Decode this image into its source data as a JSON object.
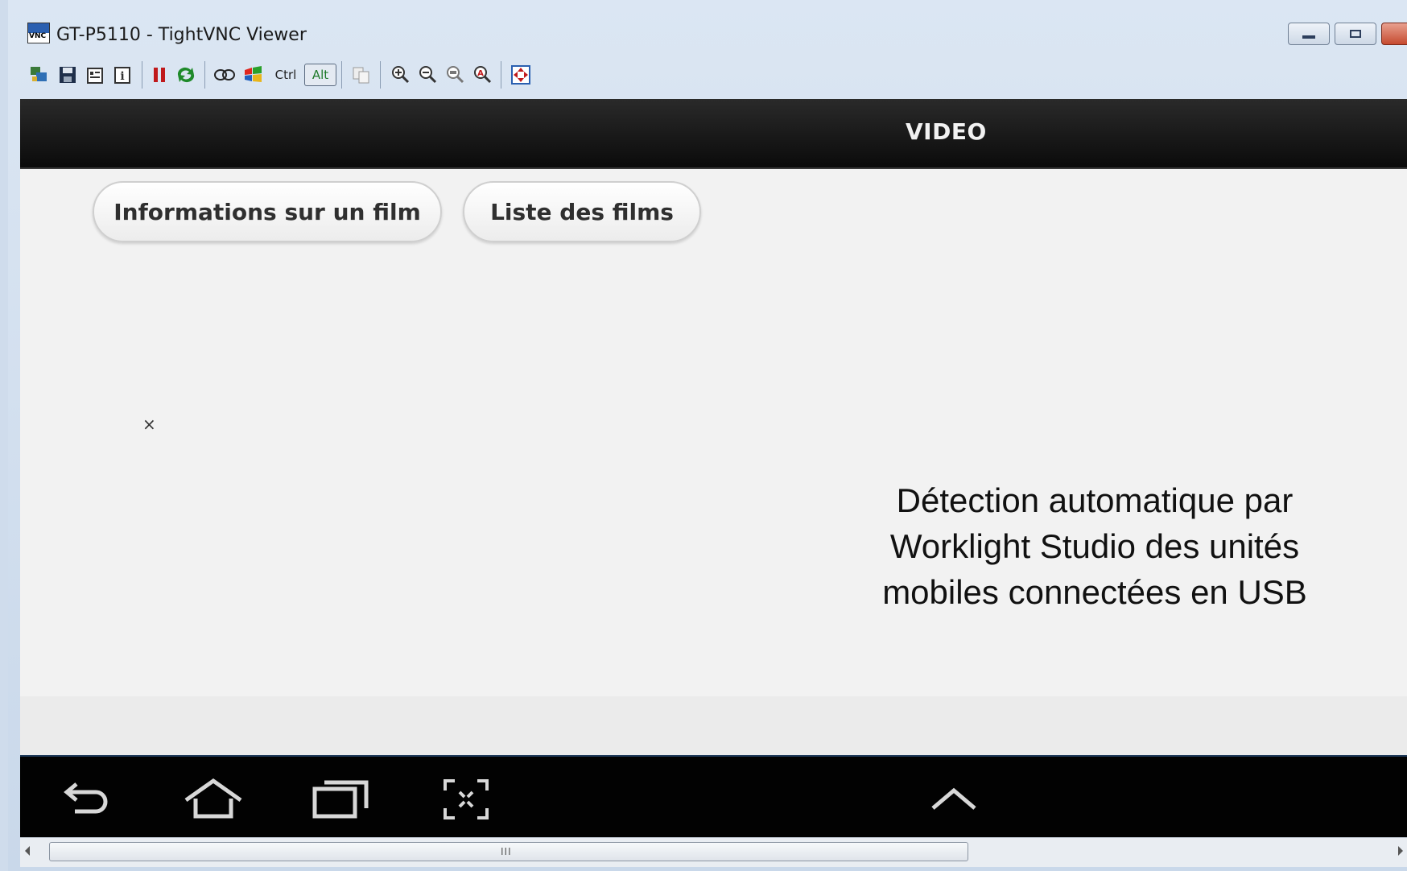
{
  "window": {
    "title": "GT-P5110 - TightVNC Viewer",
    "icon_label": "VNC"
  },
  "toolbar": {
    "items": [
      {
        "icon": "new-connection-icon"
      },
      {
        "icon": "save-icon"
      },
      {
        "icon": "options-icon"
      },
      {
        "icon": "connection-info-icon"
      },
      {
        "icon": "pause-icon"
      },
      {
        "icon": "refresh-icon"
      },
      {
        "icon": "ctrl-alt-del-icon"
      },
      {
        "icon": "ctrl-esc-icon"
      },
      {
        "icon": "ctrl-key",
        "label": "Ctrl"
      },
      {
        "icon": "alt-key",
        "label": "Alt"
      },
      {
        "icon": "transfer-clipboard-icon"
      },
      {
        "icon": "zoom-in-icon"
      },
      {
        "icon": "zoom-out-icon"
      },
      {
        "icon": "zoom-100-icon"
      },
      {
        "icon": "zoom-auto-icon"
      },
      {
        "icon": "fullscreen-icon"
      }
    ]
  },
  "app": {
    "header_title": "VIDEO",
    "buttons": [
      {
        "label": "Informations sur un film"
      },
      {
        "label": "Liste des films"
      }
    ],
    "x_mark": "×"
  },
  "caption": [
    "Détection automatique par",
    "Worklight Studio des unités",
    "mobiles connectées en USB"
  ],
  "navbar": {
    "items": [
      "back-icon",
      "home-icon",
      "recent-apps-icon",
      "screenshot-icon",
      "chevron-up-icon"
    ]
  },
  "scrollbar": {
    "grip": "III"
  }
}
